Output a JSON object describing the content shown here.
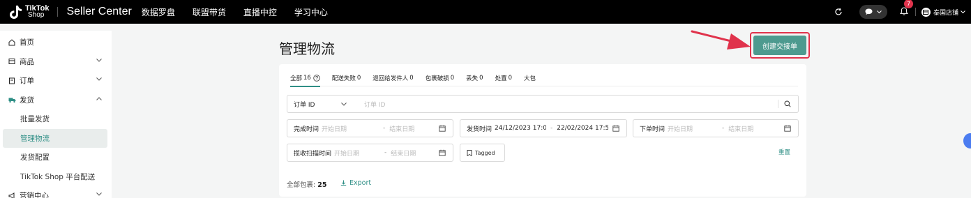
{
  "topbar": {
    "logo_line1": "TikTok",
    "logo_line2": "Shop",
    "app_name": "Seller Center",
    "nav": [
      "数据罗盘",
      "联盟带货",
      "直播中控",
      "学习中心"
    ],
    "notification_count": "7",
    "shop_label": "泰国店铺"
  },
  "sidebar": {
    "items": [
      {
        "label": "首页",
        "icon": "home-icon"
      },
      {
        "label": "商品",
        "icon": "product-icon"
      },
      {
        "label": "订单",
        "icon": "order-icon"
      },
      {
        "label": "发货",
        "icon": "truck-icon"
      }
    ],
    "sub_items": [
      "批量发货",
      "管理物流",
      "发货配置",
      "TikTok Shop 平台配送"
    ],
    "partial_item": "营销中心"
  },
  "page": {
    "title": "管理物流",
    "create_button": "创建交接单"
  },
  "tabs": [
    {
      "label": "全部",
      "count": "16"
    },
    {
      "label": "配送失败",
      "count": "0"
    },
    {
      "label": "退回给发件人",
      "count": "0"
    },
    {
      "label": "包裹破损",
      "count": "0"
    },
    {
      "label": "丢失",
      "count": "0"
    },
    {
      "label": "处置",
      "count": "0"
    },
    {
      "label": "大包",
      "count": ""
    }
  ],
  "filters": {
    "id_type": "订单 ID",
    "id_placeholder": "订单 ID",
    "completion": {
      "label": "完成时间",
      "start": "开始日期",
      "end": "结束日期"
    },
    "ship_time": {
      "label": "发货时间",
      "start": "24/12/2023 17:0",
      "end": "22/02/2024 17:5"
    },
    "order_time": {
      "label": "下单时间",
      "start": "开始日期",
      "end": "结束日期"
    },
    "scan_time": {
      "label": "揽收扫描时间",
      "start": "开始日期",
      "end": "结束日期"
    },
    "tagged": "Tagged",
    "reset": "重置"
  },
  "summary": {
    "total_label": "全部包裹:",
    "total_value": "25",
    "export": "Export"
  },
  "colors": {
    "accent": "#2f8f86",
    "button": "#4d9a8f",
    "highlight": "#e0334c"
  }
}
